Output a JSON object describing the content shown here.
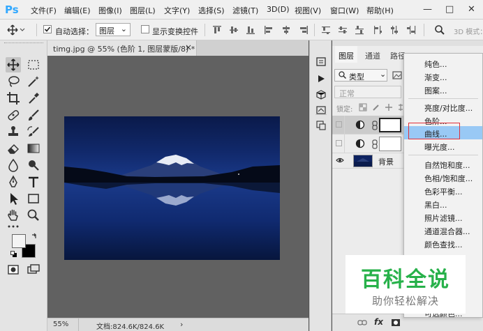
{
  "app": {
    "logo": "Ps"
  },
  "menubar": {
    "items": [
      "文件(F)",
      "编辑(E)",
      "图像(I)",
      "图层(L)",
      "文字(Y)",
      "选择(S)",
      "滤镜(T)",
      "3D(D)",
      "视图(V)",
      "窗口(W)",
      "帮助(H)"
    ],
    "window_buttons": [
      "—",
      "□",
      "✕"
    ]
  },
  "options_bar": {
    "auto_select_label": "自动选择：",
    "auto_select_checked": true,
    "layer_select_value": "图层",
    "show_transform_label": "显示变换控件",
    "show_transform_checked": false,
    "mode_3d_label": "3D 模式："
  },
  "document": {
    "tab_title": "timg.jpg @ 55% (色阶 1, 图层蒙版/8) *",
    "tab_close": "×",
    "zoom": "55%",
    "doc_info": "文档:824.6K/824.6K",
    "status_arrow": "›"
  },
  "layers_panel": {
    "tabs": [
      "图层",
      "通道",
      "路径"
    ],
    "filter_label": "类型",
    "blend_mode": "正常",
    "lock_label": "锁定:",
    "layers": [
      {
        "name": "",
        "selected": true,
        "type": "adjustment"
      },
      {
        "name": "",
        "selected": false,
        "type": "adjustment"
      },
      {
        "name": "背景",
        "selected": false,
        "type": "image"
      }
    ]
  },
  "adjustment_menu": {
    "groups": [
      [
        "纯色...",
        "渐变...",
        "图案..."
      ],
      [
        "亮度/对比度...",
        "色阶...",
        "曲线...",
        "曝光度..."
      ],
      [
        "自然饱和度...",
        "色相/饱和度...",
        "色彩平衡...",
        "黑白...",
        "照片滤镜...",
        "通道混合器...",
        "颜色查找..."
      ]
    ],
    "highlighted": "曲线...",
    "trailing_partial": "可选颜色..."
  },
  "watermark": {
    "title": "百科全说",
    "subtitle": "助你轻松解决"
  },
  "colors": {
    "highlight": "#99c9f5",
    "red_box": "#e0303a",
    "watermark_green": "#27b14a",
    "ps_blue": "#31a8ff"
  }
}
